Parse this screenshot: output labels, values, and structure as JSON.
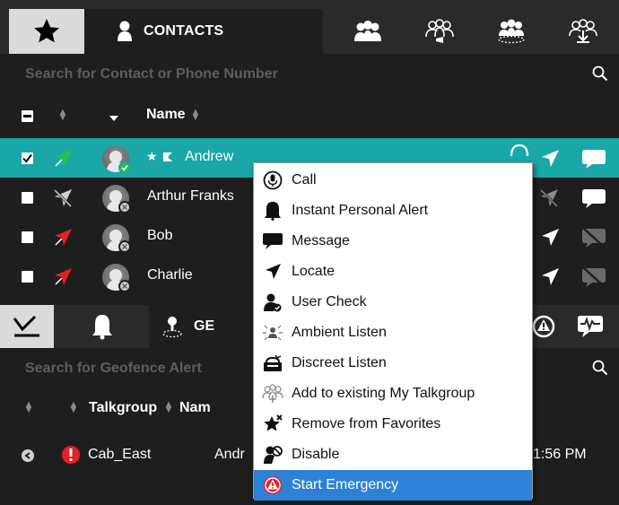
{
  "tabs": {
    "favorites_icon": "star-icon",
    "contacts_label": "CONTACTS",
    "group_icons": [
      "group-icon",
      "broadcast-group-icon",
      "dispatch-group-icon",
      "download-group-icon"
    ]
  },
  "contacts": {
    "search_placeholder": "Search for Contact or Phone Number",
    "header": {
      "name_label": "Name"
    },
    "rows": [
      {
        "name": "Andrew",
        "selected": true,
        "checked": true,
        "location": "green",
        "favorite": true
      },
      {
        "name": "Arthur Franks",
        "selected": false,
        "checked": false,
        "location": "none",
        "favorite": false
      },
      {
        "name": "Bob",
        "selected": false,
        "checked": false,
        "location": "red",
        "favorite": false
      },
      {
        "name": "Charlie",
        "selected": false,
        "checked": false,
        "location": "red",
        "favorite": false
      }
    ]
  },
  "lower_panel": {
    "geo_tab_label": "GE",
    "search_placeholder": "Search for Geofence Alert",
    "header": {
      "talkgroup_label": "Talkgroup",
      "name_label": "Nam"
    },
    "row": {
      "talkgroup": "Cab_East",
      "name": "Andr",
      "time": "1:56 PM"
    }
  },
  "context_menu": {
    "items": [
      {
        "label": "Call",
        "icon": "microphone-call-icon"
      },
      {
        "label": "Instant Personal Alert",
        "icon": "bell-alert-icon"
      },
      {
        "label": "Message",
        "icon": "speech-bubble-icon"
      },
      {
        "label": "Locate",
        "icon": "location-arrow-icon"
      },
      {
        "label": "User Check",
        "icon": "user-check-icon"
      },
      {
        "label": "Ambient Listen",
        "icon": "ambient-listen-icon"
      },
      {
        "label": "Discreet Listen",
        "icon": "discreet-listen-icon"
      },
      {
        "label": "Add to existing My Talkgroup",
        "icon": "add-talkgroup-icon"
      },
      {
        "label": "Remove from Favorites",
        "icon": "remove-favorite-icon"
      },
      {
        "label": "Disable",
        "icon": "disable-user-icon"
      },
      {
        "label": "Start Emergency",
        "icon": "emergency-icon",
        "highlighted": true
      }
    ]
  },
  "colors": {
    "selected_row": "#19a7a8",
    "menu_highlight": "#2d82d8",
    "location_green": "#2bbf4c",
    "location_red": "#e3202a",
    "emergency_red": "#e3202a"
  }
}
